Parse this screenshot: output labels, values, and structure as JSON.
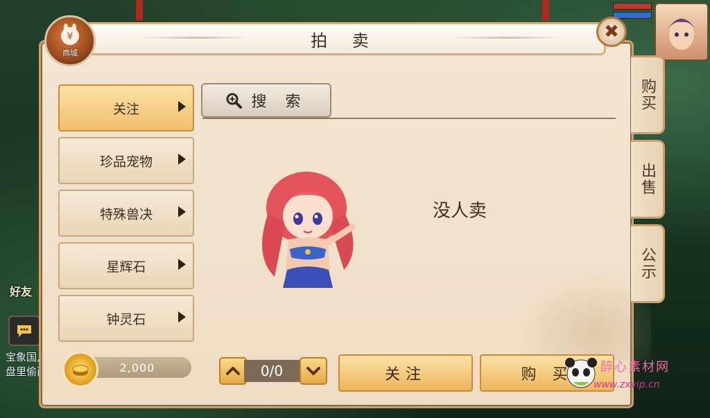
{
  "window": {
    "title": "拍 卖"
  },
  "shop": {
    "label": "商城",
    "symbol": "¥"
  },
  "close": {
    "glyph": "✖"
  },
  "side_tabs": [
    "购买",
    "出售",
    "公示"
  ],
  "categories": [
    {
      "label": "关注",
      "active": true
    },
    {
      "label": "珍品宠物",
      "active": false
    },
    {
      "label": "特殊兽决",
      "active": false
    },
    {
      "label": "星辉石",
      "active": false
    },
    {
      "label": "钟灵石",
      "active": false
    }
  ],
  "search": {
    "label": "搜 索",
    "icon": "magnifier-plus-icon"
  },
  "empty_state": {
    "message": "没人卖"
  },
  "currency": {
    "amount": "2,000",
    "icon": "gold-coin-icon"
  },
  "pager": {
    "value": "0/0"
  },
  "actions": {
    "follow_label": "关注",
    "buy_label": "购 买"
  },
  "world_hud": {
    "friends_label": "好友",
    "chat_text": "宝象国,盘里偷西",
    "colors": {
      "hp": "#c0392b",
      "mp": "#2e6fd1"
    }
  },
  "watermark": {
    "line1": "醉心素材网",
    "line2": "www.zxvip.cn"
  },
  "theme": {
    "panel_bg": "#f4e6d3",
    "accent_gold": "#f1bf6c",
    "border": "#c8a170"
  }
}
